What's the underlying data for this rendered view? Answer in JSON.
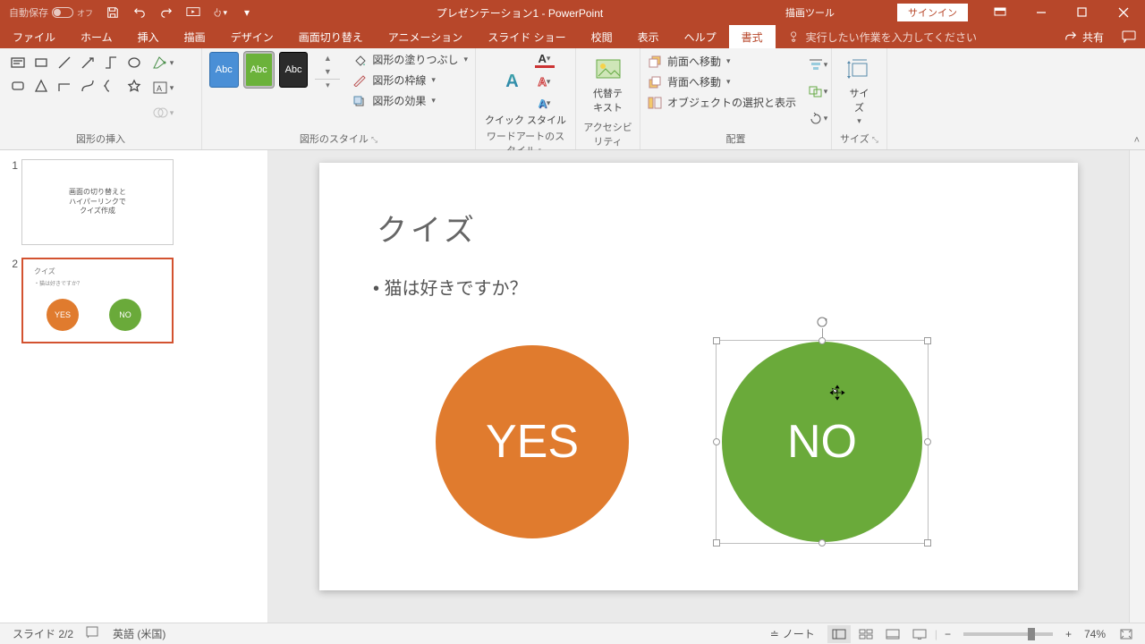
{
  "titlebar": {
    "autosave": "自動保存",
    "autosave_state": "オフ",
    "title": "プレゼンテーション1 - PowerPoint",
    "drawing_tools": "描画ツール",
    "signin": "サインイン"
  },
  "tabs": {
    "file": "ファイル",
    "home": "ホーム",
    "insert": "挿入",
    "draw": "描画",
    "design": "デザイン",
    "transitions": "画面切り替え",
    "animations": "アニメーション",
    "slideshow": "スライド ショー",
    "review": "校閲",
    "view": "表示",
    "help": "ヘルプ",
    "format": "書式",
    "tellme": "実行したい作業を入力してください",
    "share": "共有"
  },
  "ribbon": {
    "insert_shapes": "図形の挿入",
    "shape_styles": "図形のスタイル",
    "shape_fill": "図形の塗りつぶし",
    "shape_outline": "図形の枠線",
    "shape_effects": "図形の効果",
    "abc": "Abc",
    "wordart_styles": "ワードアートのスタイル",
    "quick_styles": "クイック スタイル",
    "accessibility": "アクセシビリティ",
    "alt_text": "代替テ キスト",
    "arrangement": "配置",
    "bring_forward": "前面へ移動",
    "send_backward": "背面へ移動",
    "selection_pane": "オブジェクトの選択と表示",
    "size": "サイズ"
  },
  "thumbs": {
    "slide1_line1": "画面の切り替えと",
    "slide1_line2": "ハイパーリンクで",
    "slide1_line3": "クイズ作成",
    "slide2_title": "クイズ",
    "slide2_sub": "・猫は好きですか？",
    "yes": "YES",
    "no": "NO"
  },
  "slide": {
    "title": "クイズ",
    "bullet": "• 猫は好きですか？",
    "yes": "YES",
    "no": "NO"
  },
  "status": {
    "slide_count": "スライド 2/2",
    "language": "英語 (米国)",
    "notes": "ノート",
    "zoom": "74%"
  }
}
